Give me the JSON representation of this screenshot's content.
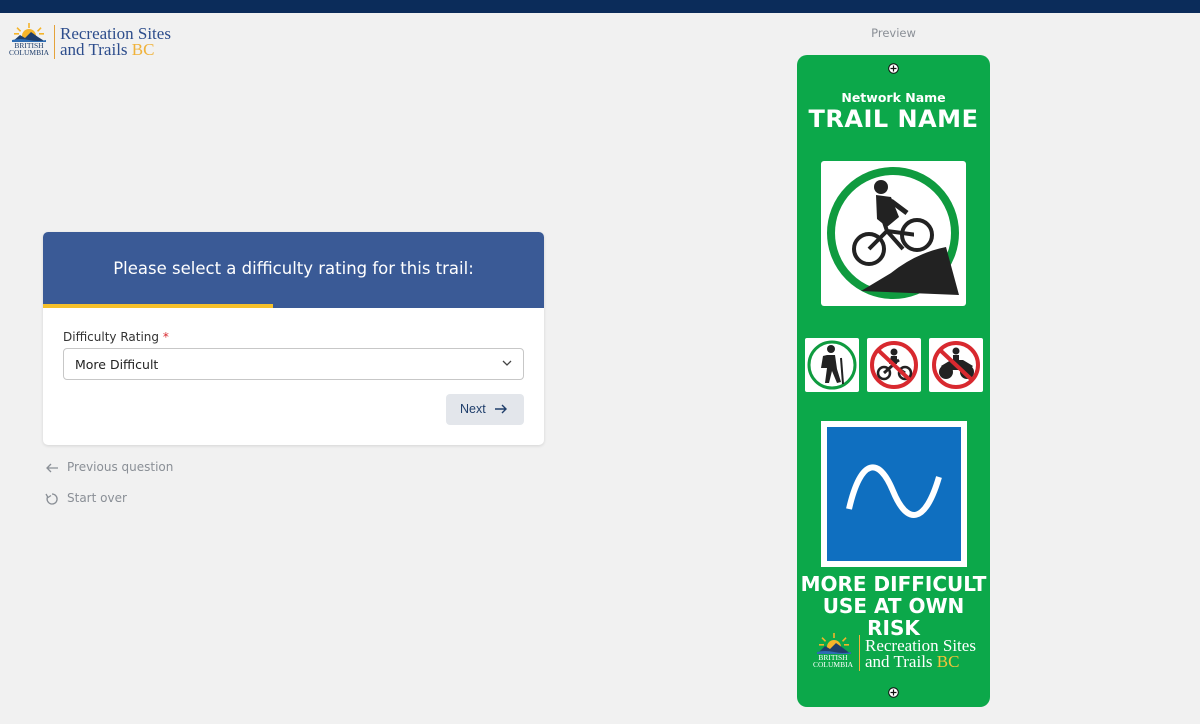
{
  "logo": {
    "word_line1": "BRITISH",
    "word_line2": "COLUMBIA",
    "title_line1": "Recreation Sites",
    "title_line2_a": "and Trails ",
    "title_line2_b": "BC"
  },
  "card": {
    "heading": "Please select a difficulty rating for this trail:",
    "progress_fraction": 0.46,
    "field_label": "Difficulty Rating",
    "required_mark": "*",
    "selected_value": "More Difficult",
    "next_label": "Next"
  },
  "nav": {
    "previous": "Previous question",
    "start_over": "Start over"
  },
  "preview": {
    "label": "Preview",
    "network_name": "Network Name",
    "trail_name": "TRAIL NAME",
    "rating_line1": "MORE DIFFICULT",
    "rating_line2": "USE AT OWN RISK",
    "sign_color": "#0ca84a",
    "difficulty_color": "#0f6fc0",
    "allowed": [
      "hiking-icon"
    ],
    "prohibited": [
      "dirt-bike-icon",
      "atv-icon"
    ]
  },
  "colors": {
    "header_bar": "#0b2c5a",
    "card_header": "#3a5a96",
    "progress": "#f5c02a"
  }
}
